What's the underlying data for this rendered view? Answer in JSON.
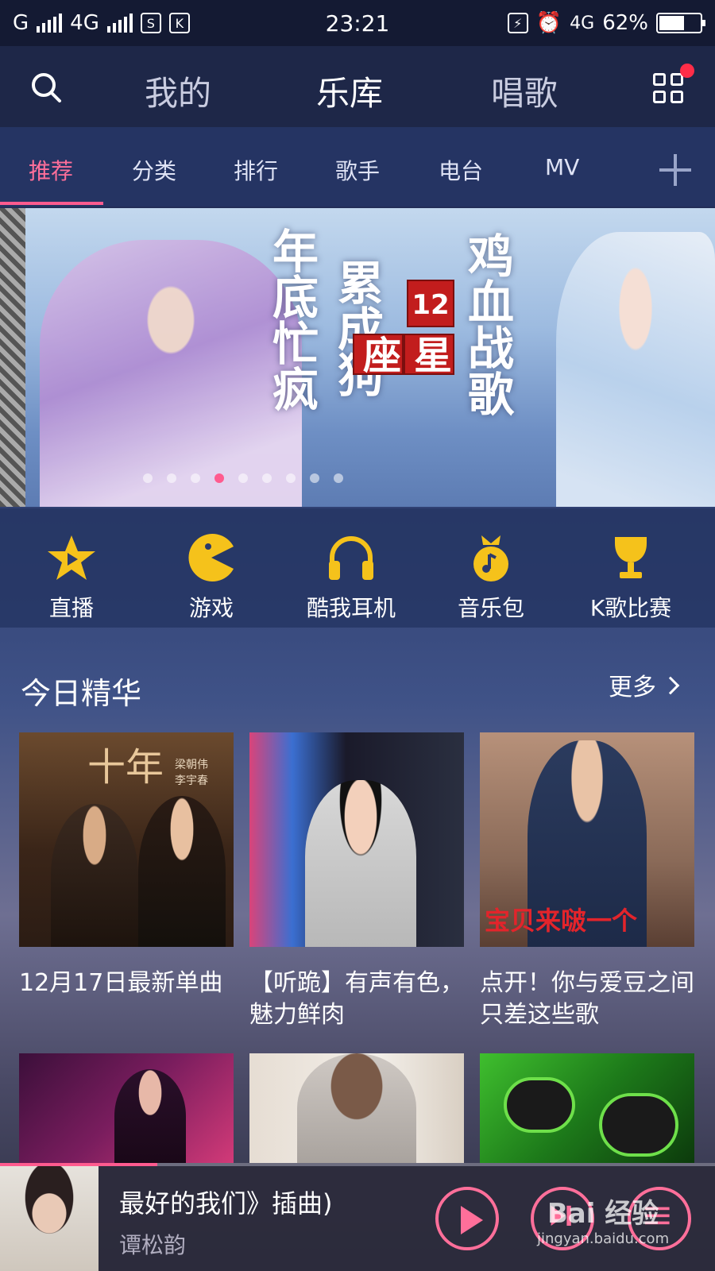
{
  "status_bar": {
    "carrier1": "G",
    "carrier2": "4G",
    "time": "23:21",
    "network": "4G",
    "battery": "62%",
    "battery_level": 0.62
  },
  "top_nav": {
    "tabs": [
      {
        "label": "我的"
      },
      {
        "label": "乐库"
      },
      {
        "label": "唱歌"
      }
    ],
    "active_tab": "乐库"
  },
  "sub_tabs": {
    "tabs": [
      {
        "label": "推荐"
      },
      {
        "label": "分类"
      },
      {
        "label": "排行"
      },
      {
        "label": "歌手"
      },
      {
        "label": "电台"
      },
      {
        "label": "MV"
      }
    ],
    "active": "推荐"
  },
  "banner": {
    "line1": "年底忙疯",
    "line2": "累成狗",
    "seal_num": "12",
    "seal_chars": [
      "星",
      "座"
    ],
    "line3": "鸡血战歌",
    "slide_count": 9,
    "active_slide": 3
  },
  "shortcuts": [
    {
      "label": "直播",
      "icon": "star-play-icon"
    },
    {
      "label": "游戏",
      "icon": "pacman-icon"
    },
    {
      "label": "酷我耳机",
      "icon": "headphones-icon"
    },
    {
      "label": "音乐包",
      "icon": "music-bag-icon"
    },
    {
      "label": "K歌比赛",
      "icon": "trophy-icon"
    }
  ],
  "section": {
    "title": "今日精华",
    "more": "更多"
  },
  "cards": [
    {
      "title": "12月17日最新单曲",
      "poster_title": "十年",
      "poster_sub1": "梁朝伟",
      "poster_sub2": "李宇春"
    },
    {
      "title": "【听跪】有声有色，魅力鲜肉"
    },
    {
      "title": "点开！你与爱豆之间只差这些歌",
      "poster_caption": "宝贝来啵一个"
    },
    {
      "title": ""
    },
    {
      "title": ""
    },
    {
      "title": ""
    }
  ],
  "player": {
    "song": "最好的我们》插曲)",
    "artist": "谭松韵",
    "progress": 0.22
  },
  "watermark": {
    "brand": "Bai 经验",
    "url": "jingyan.baidu.com"
  },
  "colors": {
    "accent": "#ff5b8f",
    "icon_yellow": "#f5c21b"
  }
}
